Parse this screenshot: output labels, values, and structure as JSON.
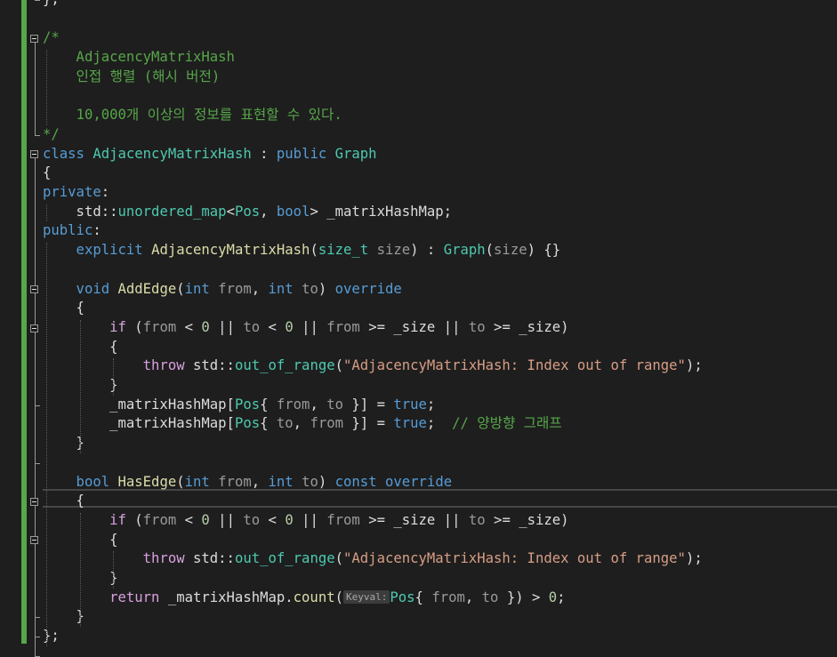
{
  "editor": {
    "lines": [
      {
        "tokens": [
          {
            "t": "};",
            "c": "txt"
          }
        ]
      },
      {
        "tokens": []
      },
      {
        "tokens": [
          {
            "t": "/*",
            "c": "cm"
          }
        ]
      },
      {
        "tokens": [
          {
            "t": "    AdjacencyMatrixHash",
            "c": "cm"
          }
        ]
      },
      {
        "tokens": [
          {
            "t": "    인접 행렬 (해시 버전)",
            "c": "cm"
          }
        ]
      },
      {
        "tokens": []
      },
      {
        "tokens": [
          {
            "t": "    10,000개 이상의 정보를 표현할 수 있다.",
            "c": "cm"
          }
        ]
      },
      {
        "tokens": [
          {
            "t": "*/",
            "c": "cm"
          }
        ]
      },
      {
        "tokens": [
          {
            "t": "class ",
            "c": "kw"
          },
          {
            "t": "AdjacencyMatrixHash",
            "c": "ty"
          },
          {
            "t": " : ",
            "c": "txt"
          },
          {
            "t": "public ",
            "c": "kw"
          },
          {
            "t": "Graph",
            "c": "ty"
          }
        ]
      },
      {
        "tokens": [
          {
            "t": "{",
            "c": "txt"
          }
        ]
      },
      {
        "tokens": [
          {
            "t": "private",
            "c": "kw"
          },
          {
            "t": ":",
            "c": "txt"
          }
        ]
      },
      {
        "tokens": [
          {
            "t": "    std",
            "c": "txt"
          },
          {
            "t": "::",
            "c": "txt"
          },
          {
            "t": "unordered_map",
            "c": "ty"
          },
          {
            "t": "<",
            "c": "txt"
          },
          {
            "t": "Pos",
            "c": "ty"
          },
          {
            "t": ", ",
            "c": "txt"
          },
          {
            "t": "bool",
            "c": "kw"
          },
          {
            "t": "> _matrixHashMap;",
            "c": "txt"
          }
        ]
      },
      {
        "tokens": [
          {
            "t": "public",
            "c": "kw"
          },
          {
            "t": ":",
            "c": "txt"
          }
        ]
      },
      {
        "tokens": [
          {
            "t": "    explicit ",
            "c": "kw"
          },
          {
            "t": "AdjacencyMatrixHash",
            "c": "fn"
          },
          {
            "t": "(",
            "c": "txt"
          },
          {
            "t": "size_t",
            "c": "ty"
          },
          {
            "t": " size",
            "c": "pm"
          },
          {
            "t": ") : ",
            "c": "txt"
          },
          {
            "t": "Graph",
            "c": "ty"
          },
          {
            "t": "(",
            "c": "txt"
          },
          {
            "t": "size",
            "c": "pm"
          },
          {
            "t": ") {}",
            "c": "txt"
          }
        ]
      },
      {
        "tokens": []
      },
      {
        "tokens": [
          {
            "t": "    void ",
            "c": "kw"
          },
          {
            "t": "AddEdge",
            "c": "fn"
          },
          {
            "t": "(",
            "c": "txt"
          },
          {
            "t": "int",
            "c": "kw"
          },
          {
            "t": " from",
            "c": "pm"
          },
          {
            "t": ", ",
            "c": "txt"
          },
          {
            "t": "int",
            "c": "kw"
          },
          {
            "t": " to",
            "c": "pm"
          },
          {
            "t": ") ",
            "c": "txt"
          },
          {
            "t": "override",
            "c": "kw"
          }
        ]
      },
      {
        "tokens": [
          {
            "t": "    {",
            "c": "txt"
          }
        ]
      },
      {
        "tokens": [
          {
            "t": "        if ",
            "c": "ctl"
          },
          {
            "t": "(",
            "c": "txt"
          },
          {
            "t": "from",
            "c": "pm"
          },
          {
            "t": " < ",
            "c": "txt"
          },
          {
            "t": "0",
            "c": "num"
          },
          {
            "t": " || ",
            "c": "txt"
          },
          {
            "t": "to",
            "c": "pm"
          },
          {
            "t": " < ",
            "c": "txt"
          },
          {
            "t": "0",
            "c": "num"
          },
          {
            "t": " || ",
            "c": "txt"
          },
          {
            "t": "from",
            "c": "pm"
          },
          {
            "t": " >= _size || ",
            "c": "txt"
          },
          {
            "t": "to",
            "c": "pm"
          },
          {
            "t": " >= _size)",
            "c": "txt"
          }
        ]
      },
      {
        "tokens": [
          {
            "t": "        {",
            "c": "txt"
          }
        ]
      },
      {
        "tokens": [
          {
            "t": "            throw ",
            "c": "ctl"
          },
          {
            "t": "std",
            "c": "txt"
          },
          {
            "t": "::",
            "c": "txt"
          },
          {
            "t": "out_of_range",
            "c": "ty"
          },
          {
            "t": "(",
            "c": "txt"
          },
          {
            "t": "\"AdjacencyMatrixHash: Index out of range\"",
            "c": "str"
          },
          {
            "t": ");",
            "c": "txt"
          }
        ]
      },
      {
        "tokens": [
          {
            "t": "        }",
            "c": "txt"
          }
        ]
      },
      {
        "tokens": [
          {
            "t": "        _matrixHashMap[",
            "c": "txt"
          },
          {
            "t": "Pos",
            "c": "ty"
          },
          {
            "t": "{ ",
            "c": "txt"
          },
          {
            "t": "from",
            "c": "pm"
          },
          {
            "t": ", ",
            "c": "txt"
          },
          {
            "t": "to",
            "c": "pm"
          },
          {
            "t": " }] = ",
            "c": "txt"
          },
          {
            "t": "true",
            "c": "kw"
          },
          {
            "t": ";",
            "c": "txt"
          }
        ]
      },
      {
        "tokens": [
          {
            "t": "        _matrixHashMap[",
            "c": "txt"
          },
          {
            "t": "Pos",
            "c": "ty"
          },
          {
            "t": "{ ",
            "c": "txt"
          },
          {
            "t": "to",
            "c": "pm"
          },
          {
            "t": ", ",
            "c": "txt"
          },
          {
            "t": "from",
            "c": "pm"
          },
          {
            "t": " }] = ",
            "c": "txt"
          },
          {
            "t": "true",
            "c": "kw"
          },
          {
            "t": ";  ",
            "c": "txt"
          },
          {
            "t": "// 양방향 그래프",
            "c": "cm"
          }
        ]
      },
      {
        "tokens": [
          {
            "t": "    }",
            "c": "txt"
          }
        ]
      },
      {
        "tokens": []
      },
      {
        "tokens": [
          {
            "t": "    bool ",
            "c": "kw"
          },
          {
            "t": "HasEdge",
            "c": "fn"
          },
          {
            "t": "(",
            "c": "txt"
          },
          {
            "t": "int",
            "c": "kw"
          },
          {
            "t": " from",
            "c": "pm"
          },
          {
            "t": ", ",
            "c": "txt"
          },
          {
            "t": "int",
            "c": "kw"
          },
          {
            "t": " to",
            "c": "pm"
          },
          {
            "t": ") ",
            "c": "txt"
          },
          {
            "t": "const ",
            "c": "kw"
          },
          {
            "t": "override",
            "c": "kw"
          }
        ]
      },
      {
        "tokens": [
          {
            "t": "    {",
            "c": "txt"
          }
        ]
      },
      {
        "tokens": [
          {
            "t": "        if ",
            "c": "ctl"
          },
          {
            "t": "(",
            "c": "txt"
          },
          {
            "t": "from",
            "c": "pm"
          },
          {
            "t": " < ",
            "c": "txt"
          },
          {
            "t": "0",
            "c": "num"
          },
          {
            "t": " || ",
            "c": "txt"
          },
          {
            "t": "to",
            "c": "pm"
          },
          {
            "t": " < ",
            "c": "txt"
          },
          {
            "t": "0",
            "c": "num"
          },
          {
            "t": " || ",
            "c": "txt"
          },
          {
            "t": "from",
            "c": "pm"
          },
          {
            "t": " >= _size || ",
            "c": "txt"
          },
          {
            "t": "to",
            "c": "pm"
          },
          {
            "t": " >= _size)",
            "c": "txt"
          }
        ]
      },
      {
        "tokens": [
          {
            "t": "        {",
            "c": "txt"
          }
        ]
      },
      {
        "tokens": [
          {
            "t": "            throw ",
            "c": "ctl"
          },
          {
            "t": "std",
            "c": "txt"
          },
          {
            "t": "::",
            "c": "txt"
          },
          {
            "t": "out_of_range",
            "c": "ty"
          },
          {
            "t": "(",
            "c": "txt"
          },
          {
            "t": "\"AdjacencyMatrixHash: Index out of range\"",
            "c": "str"
          },
          {
            "t": ");",
            "c": "txt"
          }
        ]
      },
      {
        "tokens": [
          {
            "t": "        }",
            "c": "txt"
          }
        ]
      },
      {
        "tokens": [
          {
            "t": "        return ",
            "c": "ctl"
          },
          {
            "t": "_matrixHashMap.",
            "c": "txt"
          },
          {
            "t": "count",
            "c": "fn"
          },
          {
            "t": "(",
            "c": "txt"
          },
          {
            "t": "Keyval:",
            "c": "hint"
          },
          {
            "t": "Pos",
            "c": "ty"
          },
          {
            "t": "{ ",
            "c": "txt"
          },
          {
            "t": "from",
            "c": "pm"
          },
          {
            "t": ", ",
            "c": "txt"
          },
          {
            "t": "to",
            "c": "pm"
          },
          {
            "t": " }) > ",
            "c": "txt"
          },
          {
            "t": "0",
            "c": "num"
          },
          {
            "t": ";",
            "c": "txt"
          }
        ]
      },
      {
        "tokens": [
          {
            "t": "    }",
            "c": "txt"
          }
        ]
      },
      {
        "tokens": [
          {
            "t": "};",
            "c": "txt"
          }
        ]
      }
    ]
  }
}
